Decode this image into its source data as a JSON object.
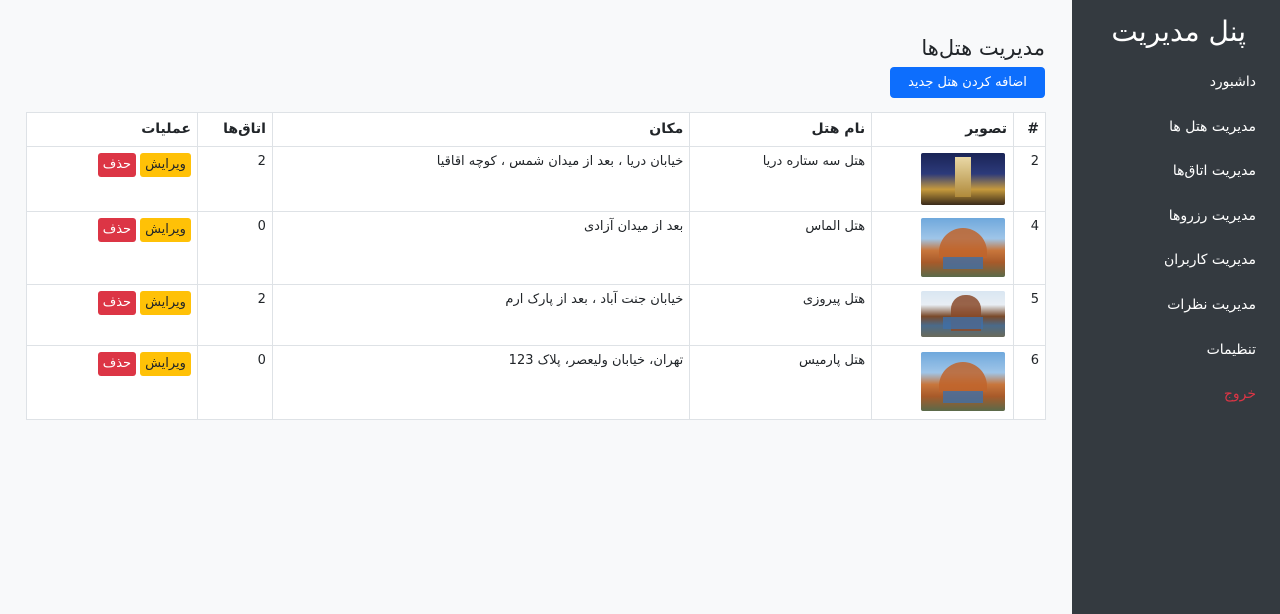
{
  "sidebar": {
    "title": "پنل مدیریت",
    "items": [
      {
        "label": "داشبورد"
      },
      {
        "label": "مدیریت هتل ها"
      },
      {
        "label": "مدیریت اتاق‌ها"
      },
      {
        "label": "مدیریت رزروها"
      },
      {
        "label": "مدیریت کاربران"
      },
      {
        "label": "مدیریت نظرات"
      },
      {
        "label": "تنظیمات"
      },
      {
        "label": "خروج"
      }
    ],
    "logout_color": "#dc3545"
  },
  "main": {
    "title": "مدیریت هتل‌ها",
    "add_button": "اضافه کردن هتل جدید",
    "accent_color": "#0d6efd"
  },
  "table": {
    "headers": [
      "#",
      "تصویر",
      "نام هتل",
      "مکان",
      "اتاق‌ها",
      "عملیات"
    ],
    "rows": [
      {
        "id": "2",
        "image": "hotel-photo",
        "name": "هتل سه ستاره دریا",
        "location": "خیابان دریا ، بعد از میدان شمس ، کوچه اقاقیا",
        "rooms": "2",
        "edit": "ویرایش",
        "delete": "حذف"
      },
      {
        "id": "4",
        "image": "hotel-photo",
        "name": "هتل الماس",
        "location": "بعد از میدان آزادی",
        "rooms": "0",
        "edit": "ویرایش",
        "delete": "حذف"
      },
      {
        "id": "5",
        "image": "hotel-photo",
        "name": "هتل پیروزی",
        "location": "خیابان جنت آباد ، بعد از پارک ارم",
        "rooms": "2",
        "edit": "ویرایش",
        "delete": "حذف"
      },
      {
        "id": "6",
        "image": "hotel-photo",
        "name": "هتل پارمیس",
        "location": "تهران، خیابان ولیعصر، پلاک 123",
        "rooms": "0",
        "edit": "ویرایش",
        "delete": "حذف"
      }
    ]
  }
}
